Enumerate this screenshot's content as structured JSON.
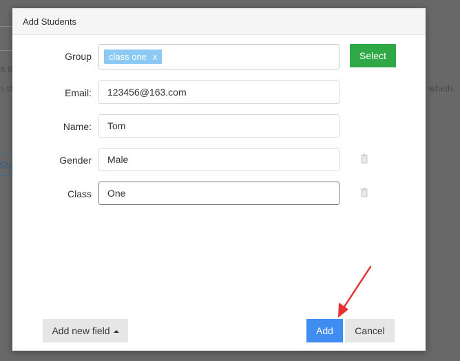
{
  "background": {
    "fragments": [
      {
        "text": "is tl"
      },
      {
        "text": "n st"
      },
      {
        "text": "ify wheth"
      }
    ],
    "stu_button": "Stu"
  },
  "modal": {
    "title": "Add Students",
    "rows": [
      {
        "label": "Group",
        "type": "tags",
        "tags": [
          "class one"
        ],
        "tag_remove": "x",
        "button": "Select"
      },
      {
        "label": "Email:",
        "value": "123456@163.com"
      },
      {
        "label": "Name:",
        "value": "Tom"
      },
      {
        "label": "Gender",
        "value": "Male",
        "removable": true
      },
      {
        "label": "Class",
        "value": "One",
        "removable": true,
        "focused": true
      }
    ],
    "footer": {
      "add_new_field": "Add new field",
      "add": "Add",
      "cancel": "Cancel"
    }
  },
  "colors": {
    "select_button": "#2fa845",
    "add_button": "#3f8df0",
    "tag": "#8cc9f5",
    "annotation_arrow": "#e8302e"
  },
  "icons": {
    "trash": "trash-icon",
    "caret": "caret-up-icon",
    "annotation": "red-arrow-annotation"
  }
}
